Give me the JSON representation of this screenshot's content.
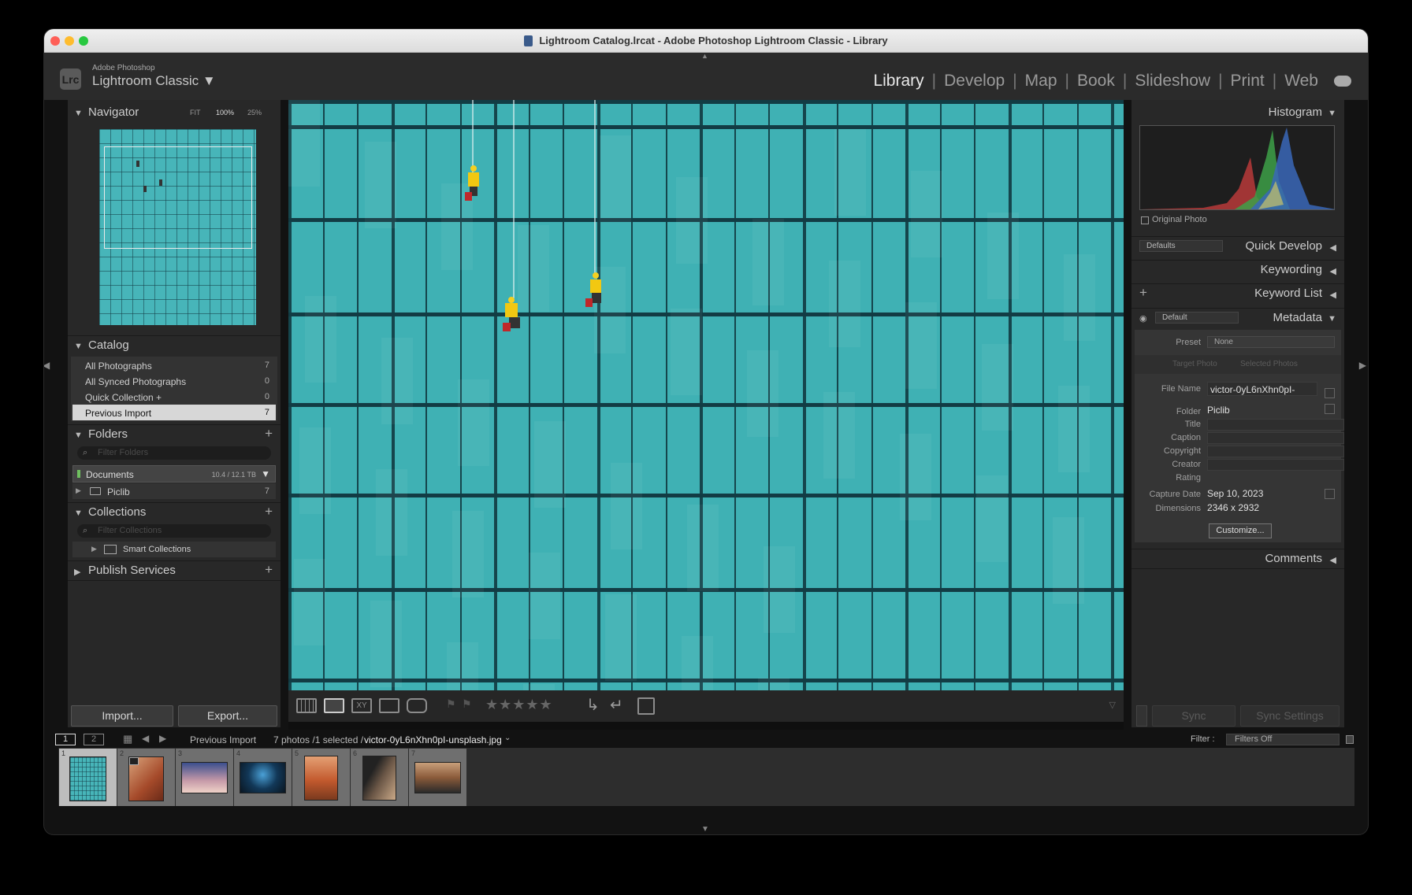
{
  "window": {
    "title": "Lightroom Catalog.lrcat - Adobe Photoshop Lightroom Classic - Library"
  },
  "identity": {
    "logo_text": "Lrc",
    "small": "Adobe Photoshop",
    "name": "Lightroom Classic ▼"
  },
  "modules": [
    "Library",
    "Develop",
    "Map",
    "Book",
    "Slideshow",
    "Print",
    "Web"
  ],
  "navigator": {
    "title": "Navigator",
    "zoom_fit": "FIT",
    "zoom_100": "100%",
    "zoom_25": "25%"
  },
  "catalog": {
    "title": "Catalog",
    "items": [
      {
        "label": "All Photographs",
        "count": "7"
      },
      {
        "label": "All Synced Photographs",
        "count": "0"
      },
      {
        "label": "Quick Collection +",
        "count": "0"
      },
      {
        "label": "Previous Import",
        "count": "7"
      }
    ]
  },
  "folders": {
    "title": "Folders",
    "filter_placeholder": "Filter Folders",
    "volume": {
      "name": "Documents",
      "size": "10.4 / 12.1 TB"
    },
    "items": [
      {
        "label": "Piclib",
        "count": "7"
      }
    ]
  },
  "collections": {
    "title": "Collections",
    "filter_placeholder": "Filter Collections",
    "items": [
      {
        "label": "Smart Collections"
      }
    ]
  },
  "publish": {
    "title": "Publish Services"
  },
  "left_buttons": {
    "import": "Import...",
    "export": "Export..."
  },
  "histogram": {
    "title": "Histogram",
    "original_photo": "Original Photo"
  },
  "quick_develop": {
    "title": "Quick Develop",
    "preset": "Defaults"
  },
  "keywording": {
    "title": "Keywording"
  },
  "keyword_list": {
    "title": "Keyword List"
  },
  "metadata": {
    "title": "Metadata",
    "preset_select": "Default",
    "preset_label": "Preset",
    "preset_value": "None",
    "target_photo": "Target Photo",
    "selected_photos": "Selected Photos",
    "file_name_label": "File Name",
    "file_name": "victor-0yL6nXhn0pI-",
    "folder_label": "Folder",
    "folder": "Piclib",
    "title_label": "Title",
    "caption_label": "Caption",
    "copyright_label": "Copyright",
    "creator_label": "Creator",
    "rating_label": "Rating",
    "capture_date_label": "Capture Date",
    "capture_date": "Sep 10, 2023",
    "dimensions_label": "Dimensions",
    "dimensions": "2346 x 2932",
    "customize": "Customize..."
  },
  "comments": {
    "title": "Comments"
  },
  "sync": {
    "sync": "Sync",
    "sync_settings": "Sync Settings"
  },
  "filmstrip": {
    "screen1": "1",
    "screen2": "2",
    "source": "Previous Import",
    "info": "7 photos /1 selected /",
    "filename": "victor-0yL6nXhn0pI-unsplash.jpg",
    "filter_label": "Filter :",
    "filter_value": "Filters Off",
    "thumbs": [
      "1",
      "2",
      "3",
      "4",
      "5",
      "6",
      "7"
    ]
  },
  "rating_stars": "★★★★★",
  "colors": {
    "accent_photo": "#3fb1b4",
    "panel": "#282828",
    "highlight": "#d4d4d4"
  }
}
